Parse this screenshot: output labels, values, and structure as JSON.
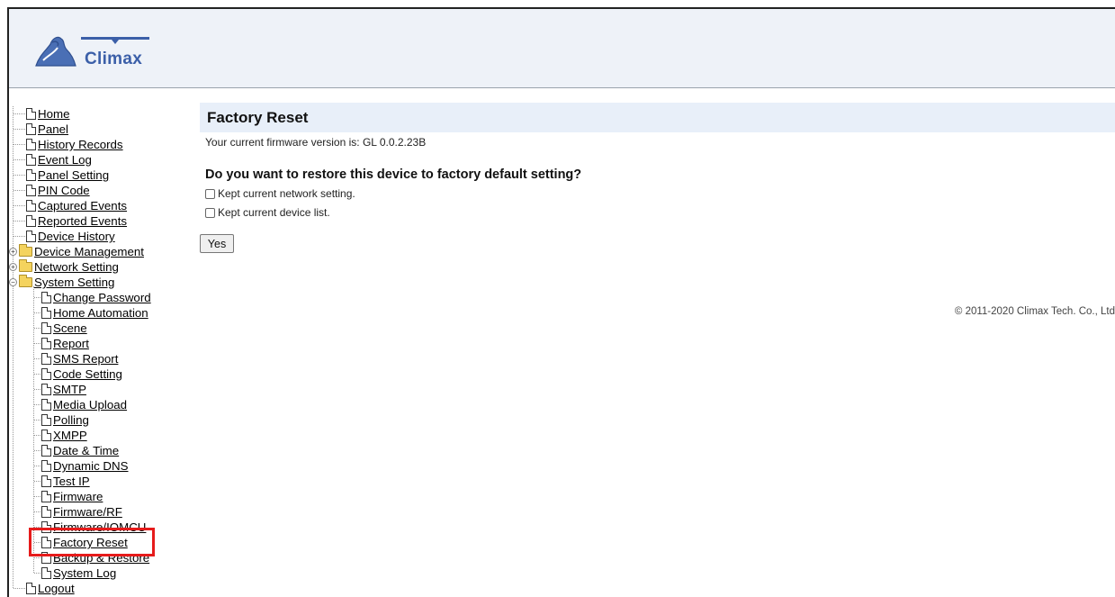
{
  "header": {
    "logo_text": "Climax"
  },
  "sidebar": {
    "items": [
      {
        "label": "Home",
        "type": "doc",
        "level": 0
      },
      {
        "label": "Panel",
        "type": "doc",
        "level": 0
      },
      {
        "label": "History Records",
        "type": "doc",
        "level": 0
      },
      {
        "label": "Event Log",
        "type": "doc",
        "level": 0
      },
      {
        "label": "Panel Setting",
        "type": "doc",
        "level": 0
      },
      {
        "label": "PIN Code",
        "type": "doc",
        "level": 0
      },
      {
        "label": "Captured Events",
        "type": "doc",
        "level": 0
      },
      {
        "label": "Reported Events",
        "type": "doc",
        "level": 0
      },
      {
        "label": "Device History",
        "type": "doc",
        "level": 0
      },
      {
        "label": "Device Management",
        "type": "folder",
        "level": 0,
        "expander": "+"
      },
      {
        "label": "Network Setting",
        "type": "folder",
        "level": 0,
        "expander": "+"
      },
      {
        "label": "System Setting",
        "type": "folder-open",
        "level": 0,
        "expander": "−"
      },
      {
        "label": "Change Password",
        "type": "doc",
        "level": 1
      },
      {
        "label": "Home Automation",
        "type": "doc",
        "level": 1
      },
      {
        "label": "Scene",
        "type": "doc",
        "level": 1
      },
      {
        "label": "Report",
        "type": "doc",
        "level": 1
      },
      {
        "label": "SMS Report",
        "type": "doc",
        "level": 1
      },
      {
        "label": "Code Setting",
        "type": "doc",
        "level": 1
      },
      {
        "label": "SMTP",
        "type": "doc",
        "level": 1
      },
      {
        "label": "Media Upload",
        "type": "doc",
        "level": 1
      },
      {
        "label": "Polling",
        "type": "doc",
        "level": 1
      },
      {
        "label": "XMPP",
        "type": "doc",
        "level": 1
      },
      {
        "label": "Date & Time",
        "type": "doc",
        "level": 1
      },
      {
        "label": "Dynamic DNS",
        "type": "doc",
        "level": 1
      },
      {
        "label": "Test IP",
        "type": "doc",
        "level": 1
      },
      {
        "label": "Firmware",
        "type": "doc",
        "level": 1
      },
      {
        "label": "Firmware/RF",
        "type": "doc",
        "level": 1
      },
      {
        "label": "Firmware/IOMCU",
        "type": "doc",
        "level": 1
      },
      {
        "label": "Factory Reset",
        "type": "doc",
        "level": 1
      },
      {
        "label": "Backup & Restore",
        "type": "doc",
        "level": 1
      },
      {
        "label": "System Log",
        "type": "doc",
        "level": 1
      },
      {
        "label": "Logout",
        "type": "doc",
        "level": 0
      }
    ]
  },
  "main": {
    "title": "Factory Reset",
    "firmware_text": "Your current firmware version is: GL 0.0.2.23B",
    "question": "Do you want to restore this device to factory default setting?",
    "options": [
      {
        "label": "Kept current network setting.",
        "checked": false
      },
      {
        "label": "Kept current device list.",
        "checked": false
      }
    ],
    "yes_label": "Yes",
    "copyright": "© 2011-2020 Climax Tech. Co., Ltd"
  },
  "colors": {
    "highlight": "#e61b1b",
    "title_bar": "#e8eff9",
    "header_bg": "#eef2f8"
  }
}
